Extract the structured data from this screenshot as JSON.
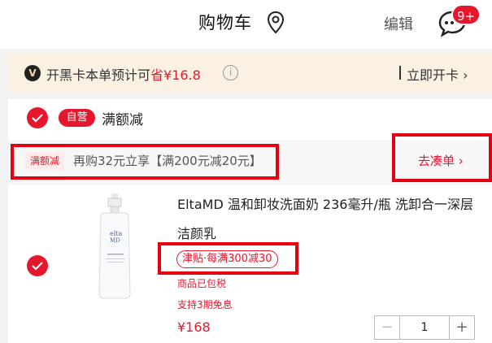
{
  "header": {
    "title": "购物车",
    "edit_label": "编辑",
    "message_badge": "9+",
    "icons": [
      "location-icon",
      "message-icon"
    ]
  },
  "vip_banner": {
    "logo": "V",
    "text_prefix": "开黑卡本单预计可",
    "text_amount": "省¥16.8",
    "info_glyph": "i",
    "action": "立即开卡",
    "action_arrow": "›"
  },
  "shop": {
    "tag": "自营",
    "name": "满额减",
    "checked": true
  },
  "promo": {
    "tag": "满额减",
    "text": "再购32元立享【满200元减20元】",
    "action": "去凑单",
    "action_arrow": "›"
  },
  "item": {
    "checked": true,
    "title": "EltaMD 温和卸妆洗面奶 236毫升/瓶 洗卸合一深层洁颜乳",
    "subsidy_tag": "津贴·每满300减30",
    "tax_note": "商品已包税",
    "installment": "支持3期免息",
    "price": "¥168",
    "quantity": "1",
    "minus": "−",
    "plus": "+",
    "image_brand": "elta",
    "image_brand2": "MD"
  },
  "colors": {
    "accent": "#e6162d",
    "highlight_box": "#e6000f",
    "vip_bg": "#faf1e2"
  }
}
